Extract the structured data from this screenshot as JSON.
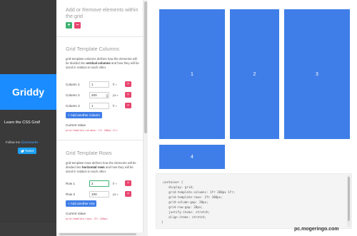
{
  "brand": {
    "title": "Griddy",
    "tagline": "Learn the CSS Grid!",
    "follow_prefix": "Follow me",
    "follow_handle": "@sularwebs",
    "tweet_label": "Tweet"
  },
  "sections": {
    "elements": {
      "title": "Add or Remove elements within the grid",
      "add_label": "+",
      "remove_label": "−"
    },
    "columns": {
      "title": "Grid Template Columns",
      "desc_parts": [
        "grid-template-columns defines how the elements will be divided into ",
        "vertical columns",
        " and how they will be sized in relation to each other."
      ],
      "rows": [
        {
          "label": "Column 1",
          "value": "1",
          "unit": "fr"
        },
        {
          "label": "Column 2",
          "value": "200",
          "unit": "px"
        },
        {
          "label": "Column 3",
          "value": "1",
          "unit": "fr"
        }
      ],
      "add_label": "+ Add another column",
      "current_label": "Current Value",
      "current_value": "grid-template-columns: 1fr 200px 1fr;"
    },
    "rows_section": {
      "title": "Grid Template Rows",
      "desc_parts": [
        "grid-template-rows defines how the elements will be divided into ",
        "horizontal rows",
        " and how they will be sized in relation to each other."
      ],
      "rows": [
        {
          "label": "Row 1",
          "value": "2",
          "unit": "fr"
        },
        {
          "label": "Row 2",
          "value": "100",
          "unit": "px"
        }
      ],
      "add_label": "+ Add another row",
      "current_label": "Current Value",
      "current_value": "grid-template-rows: 2fr 100px;"
    },
    "delete_label": "×"
  },
  "preview": {
    "cells": [
      "1",
      "2",
      "3",
      "4"
    ],
    "code_lines": [
      ".container {",
      "    display: grid;",
      "    grid-template-columns: 1fr 200px 1fr;",
      "    grid-template-rows: 2fr 100px;",
      "    grid-column-gap: 20px;",
      "    grid-row-gap: 20px;",
      "    justify-items: stretch;",
      "    align-items: stretch;",
      "}"
    ]
  },
  "watermark": "pc.mogeringo.com",
  "colors": {
    "brand_blue": "#1a8cff",
    "cell_blue": "#3f7ee8",
    "add_green": "#3cb371",
    "delete_red": "#e8456f",
    "sidebar_dark": "#3a3a3a"
  }
}
